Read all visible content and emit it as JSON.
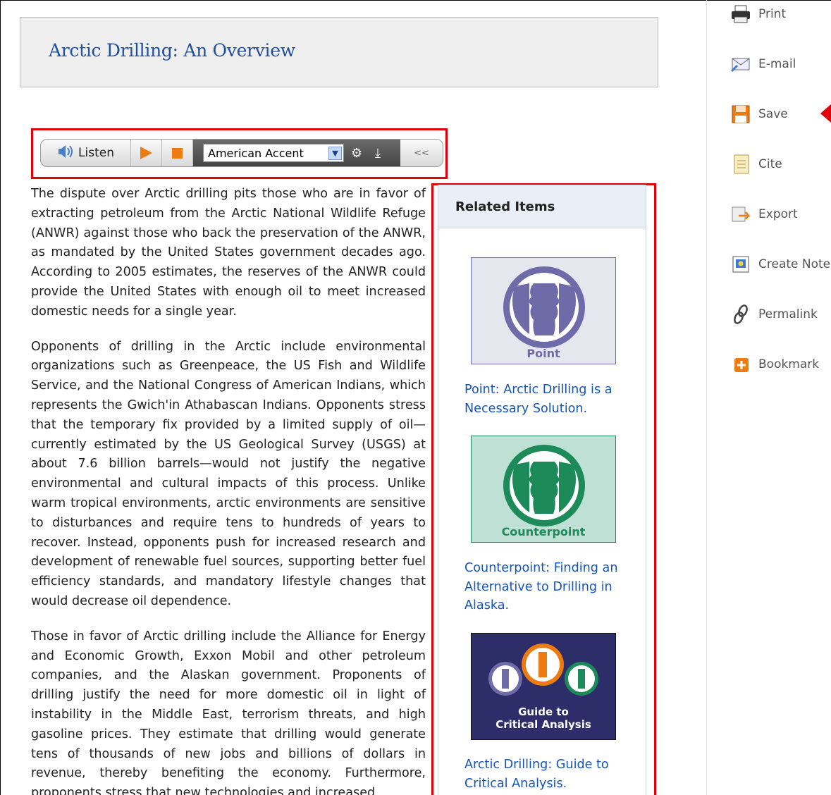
{
  "page": {
    "title": "Arctic Drilling: An Overview"
  },
  "listen_toolbar": {
    "listen_label": "Listen",
    "accent_selected": "American Accent",
    "collapse_glyph": "<<"
  },
  "article": {
    "paragraphs": [
      "The dispute over Arctic drilling pits those who are in favor of extracting petroleum from the Arctic National Wildlife Refuge (ANWR) against those who back the preservation of the ANWR, as mandated by the United States government decades ago. According to 2005 estimates, the reserves of the ANWR could provide the United States with enough oil to meet increased domestic needs for a single year.",
      "Opponents of drilling in the Arctic include environmental organizations such as Greenpeace, the US Fish and Wildlife Service, and the National Congress of American Indians, which represents the Gwich'in Athabascan Indians. Opponents stress that the temporary fix provided by a limited supply of oil—currently estimated by the US Geological Survey (USGS) at about 7.6 billion barrels—would not justify the negative environmental and cultural impacts of this process. Unlike warm tropical environments, arctic environments are sensitive to disturbances and require tens to hundreds of years to recover. Instead, opponents push for increased research and development of renewable fuel sources, supporting better fuel efficiency standards, and mandatory lifestyle changes that would decrease oil dependence.",
      "Those in favor of Arctic drilling include the Alliance for Energy and Economic Growth, Exxon Mobil and other petroleum companies, and the Alaskan government. Proponents of drilling justify the need for more domestic oil in light of instability in the Middle East, terrorism threats, and high gasoline prices. They estimate that drilling would generate tens of thousands of new jobs and billions of dollars in revenue, thereby benefiting the economy. Furthermore, proponents stress that new technologies and increased"
    ]
  },
  "related": {
    "heading": "Related Items",
    "items": [
      {
        "thumb_label": "Point",
        "link": "Point: Arctic Drilling is a Necessary Solution."
      },
      {
        "thumb_label": "Counterpoint",
        "link": "Counterpoint: Finding an Alternative to Drilling in Alaska."
      },
      {
        "thumb_label": "Guide to Critical Analysis",
        "link": "Arctic Drilling: Guide to Critical Analysis."
      }
    ]
  },
  "tools": [
    {
      "label": "Print",
      "icon": "printer-icon"
    },
    {
      "label": "E-mail",
      "icon": "email-icon"
    },
    {
      "label": "Save",
      "icon": "floppy-disk-icon"
    },
    {
      "label": "Cite",
      "icon": "document-icon"
    },
    {
      "label": "Export",
      "icon": "export-icon"
    },
    {
      "label": "Create Note",
      "icon": "note-icon"
    },
    {
      "label": "Permalink",
      "icon": "link-icon"
    },
    {
      "label": "Bookmark",
      "icon": "plus-icon"
    }
  ],
  "colors": {
    "title": "#1f4fa0",
    "link": "#1655b8",
    "highlight": "#e0000a",
    "accent_orange": "#ee7a12",
    "point_purple": "#6f6aa8",
    "counterpoint_green": "#1d8a5a"
  }
}
